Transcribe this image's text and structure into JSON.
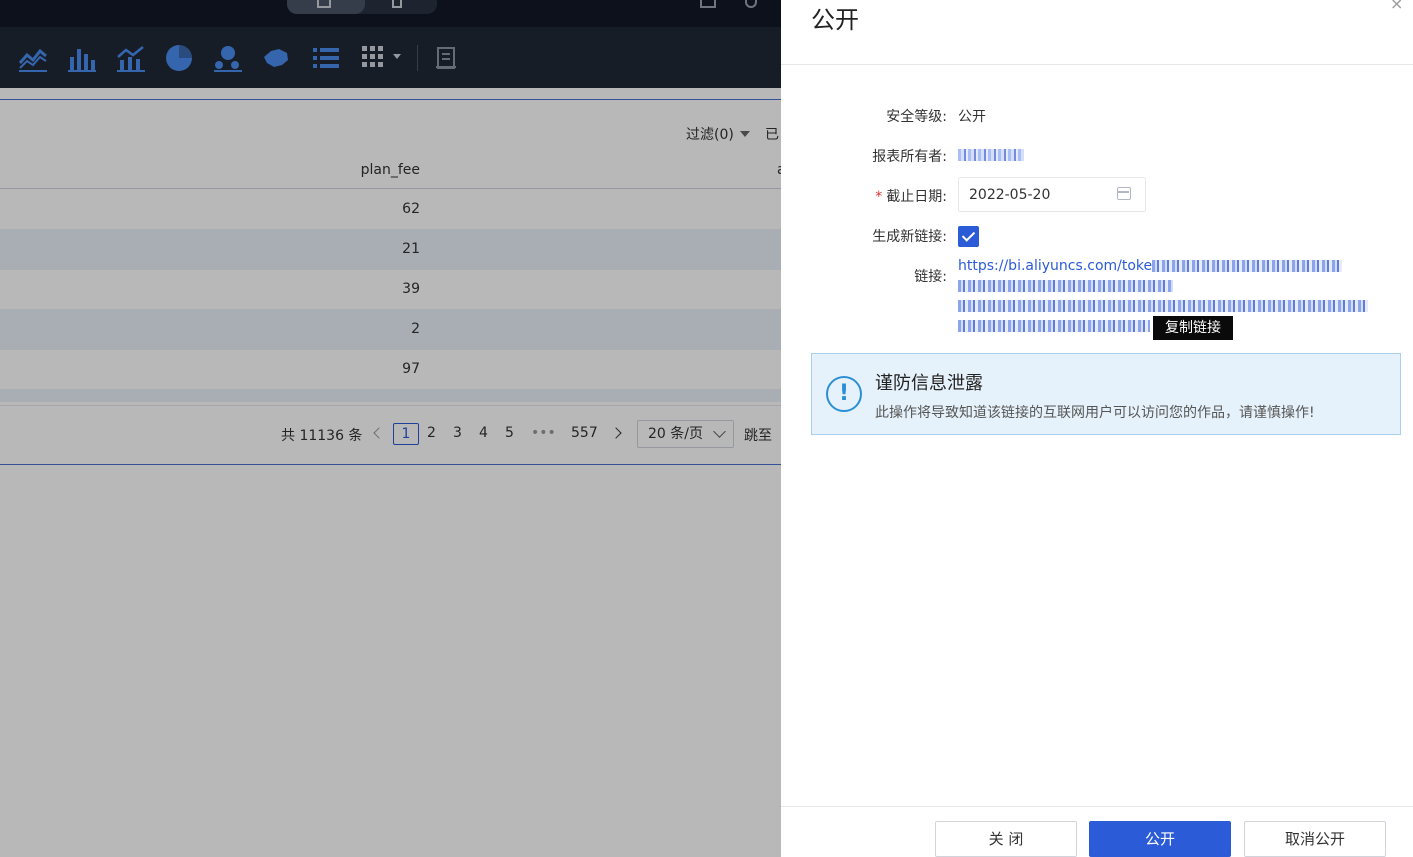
{
  "background": {
    "filter_label": "过滤(0)",
    "filter_extra": "已",
    "column_header": "plan_fee",
    "column_next": "a",
    "rows": [
      "62",
      "21",
      "39",
      "2",
      "97"
    ],
    "pagination": {
      "total": "共 11136 条",
      "pages": [
        "1",
        "2",
        "3",
        "4",
        "5"
      ],
      "ellipsis": "•••",
      "last_page": "557",
      "page_size": "20 条/页",
      "jump_to": "跳至"
    },
    "toolbar_icons": [
      "line-chart-icon",
      "bar-chart-icon",
      "combo-chart-icon",
      "pie-chart-icon",
      "scatter-chart-icon",
      "map-chart-icon",
      "list-icon",
      "grid-menu-icon",
      "note-icon"
    ]
  },
  "drawer": {
    "title": "公开",
    "close_glyph": "×",
    "fields": {
      "security_label": "安全等级:",
      "security_value": "公开",
      "owner_label": "报表所有者:",
      "deadline_label": "截止日期:",
      "deadline_required": "*",
      "deadline_value": "2022-05-20",
      "newlink_label": "生成新链接:",
      "link_label": "链接:",
      "link_prefix": "https://bi.aliyuncs.com/toke"
    },
    "copy_button": "复制链接",
    "alert": {
      "title": "谨防信息泄露",
      "description": "此操作将导致知道该链接的互联网用户可以访问您的作品，请谨慎操作!",
      "icon_glyph": "!"
    },
    "footer": {
      "close": "关 闭",
      "public": "公开",
      "cancel_public": "取消公开"
    }
  }
}
